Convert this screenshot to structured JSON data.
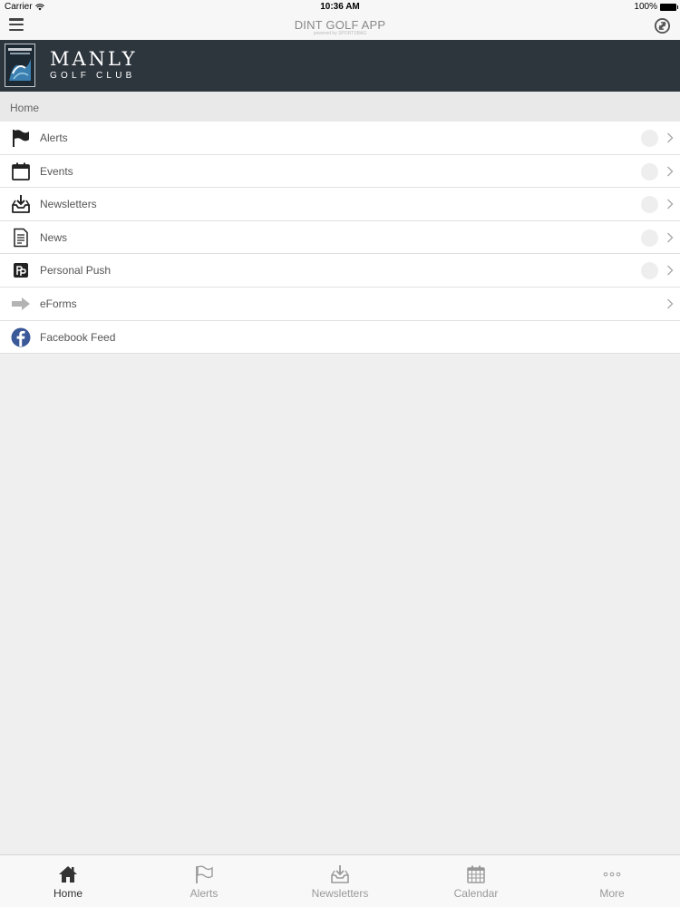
{
  "status_bar": {
    "carrier": "Carrier",
    "time": "10:36 AM",
    "battery": "100%"
  },
  "nav_bar": {
    "title": "DINT GOLF APP",
    "subtitle": "powered by SPORTSBAG"
  },
  "club_header": {
    "name": "MANLY",
    "subtitle": "GOLF CLUB"
  },
  "breadcrumb": {
    "label": "Home"
  },
  "menu": {
    "items": [
      {
        "label": "Alerts",
        "icon": "flag-icon"
      },
      {
        "label": "Events",
        "icon": "calendar-icon"
      },
      {
        "label": "Newsletters",
        "icon": "inbox-download-icon"
      },
      {
        "label": "News",
        "icon": "document-icon"
      },
      {
        "label": "Personal Push",
        "icon": "personal-push-icon"
      },
      {
        "label": "eForms",
        "icon": "arrow-right-icon"
      },
      {
        "label": "Facebook Feed",
        "icon": "facebook-icon"
      }
    ]
  },
  "tab_bar": {
    "tabs": [
      {
        "label": "Home",
        "icon": "home-icon",
        "active": true
      },
      {
        "label": "Alerts",
        "icon": "flag-icon"
      },
      {
        "label": "Newsletters",
        "icon": "inbox-download-icon"
      },
      {
        "label": "Calendar",
        "icon": "calendar-grid-icon"
      },
      {
        "label": "More",
        "icon": "ellipsis-icon"
      }
    ]
  },
  "colors": {
    "header_bg": "#2d353d",
    "page_bg": "#efefef",
    "facebook_blue": "#3b5998"
  }
}
